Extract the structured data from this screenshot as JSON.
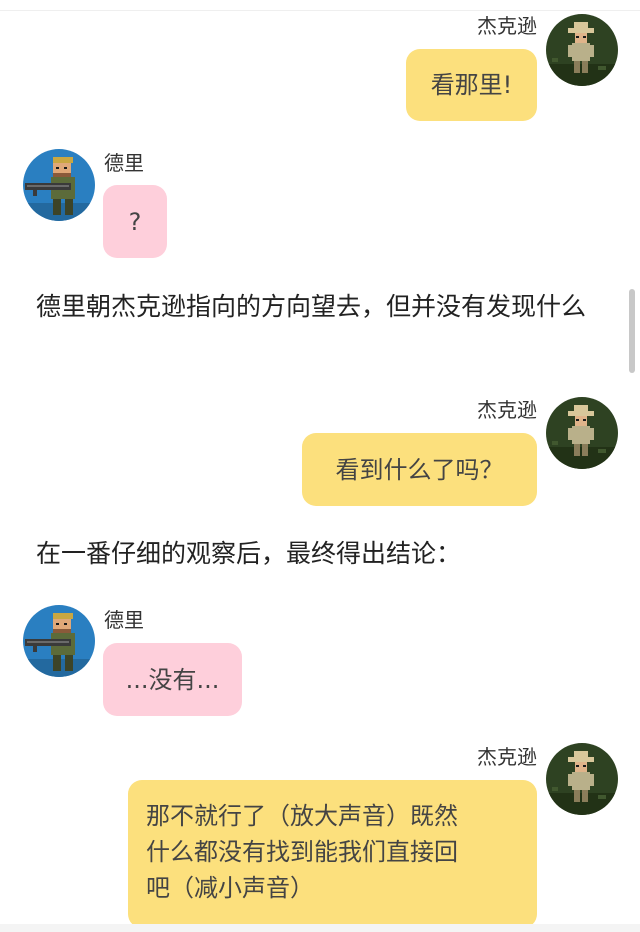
{
  "messages": [
    {
      "speaker": "杰克逊",
      "text": "看那里!"
    },
    {
      "speaker": "德里",
      "text": "?"
    },
    {
      "narration": "德里朝杰克逊指向的方向望去，但并没有发现什么"
    },
    {
      "speaker": "杰克逊",
      "text": "看到什么了吗？"
    },
    {
      "narration": "在一番仔细的观察后，最终得出结论："
    },
    {
      "speaker": "德里",
      "text": "...没有..."
    },
    {
      "speaker": "杰克逊",
      "lines": [
        "那不就行了（放大声音）既然",
        "什么都没有找到能我们直接回",
        "吧（减小声音）"
      ]
    }
  ],
  "avatars": {
    "jackson": "cowboy-hat-soldier-avatar",
    "deli": "gunner-soldier-avatar"
  },
  "colors": {
    "yellow_bubble": "#fce07d",
    "pink_bubble": "#fecfdb",
    "text": "#222222",
    "avatar_blue_bg": "#2a7fc1",
    "avatar_green_bg": "#2e4222"
  }
}
